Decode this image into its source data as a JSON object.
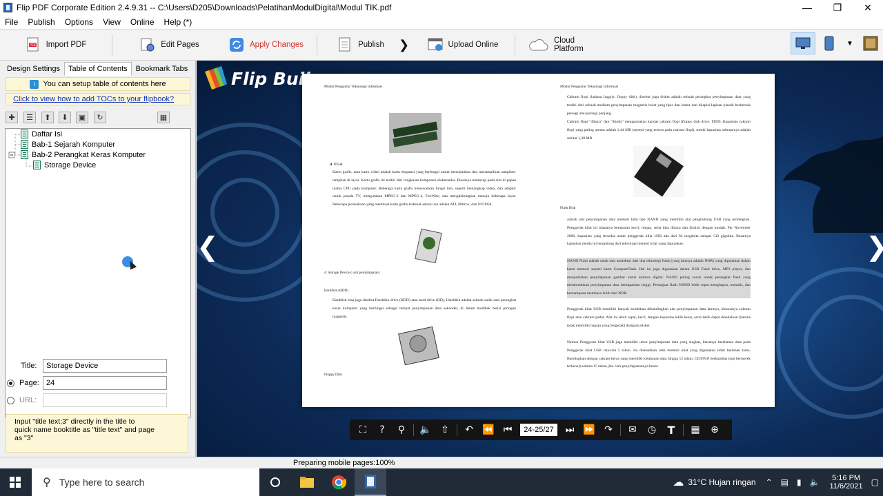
{
  "window": {
    "title": "Flip PDF Corporate Edition 2.4.9.31 -- C:\\Users\\D205\\Downloads\\PelatihanModulDigital\\Modul TIK.pdf"
  },
  "menu": [
    "File",
    "Publish",
    "Options",
    "View",
    "Online",
    "Help (*)"
  ],
  "toolbar": {
    "import": "Import PDF",
    "edit": "Edit Pages",
    "apply": "Apply Changes",
    "publish": "Publish",
    "upload": "Upload Online",
    "cloud": "Cloud Platform"
  },
  "left_panel": {
    "tabs": [
      "Design Settings",
      "Table of Contents",
      "Bookmark Tabs"
    ],
    "active_tab": "Table of Contents",
    "tip": "You can setup table of contents here",
    "howto_link": "Click to view how to add TOCs to your flipbook?",
    "tree": [
      "Daftar Isi",
      "Bab-1 Sejarah Komputer",
      "Bab-2 Perangkat Keras Komputer",
      "Storage Device"
    ],
    "title_label": "Title:",
    "title_value": "Storage Device",
    "page_label": "Page:",
    "page_value": "24",
    "url_label": "URL:",
    "url_value": "",
    "help": "Input \"title text;3\" directly in the title to\nquick name booktitle as \"title text\" and page\nas \"3\""
  },
  "viewer": {
    "logo": "Flip Buil",
    "page_indicator": "24-25/27",
    "left_page": {
      "header": "Modul Pengantar Teknologi Informasi",
      "vga_heading": "d.  VGA",
      "vga_text": "Kartu grafis, atau kartu video adalah kartu ekspansi yang berfungsi untuk menciptakan dan menampilkan tampilan-tampilan di layar. Kartu grafis ini terdiri dari rangkaian komponen elektronika. Biasanya tertancap pada slot di papan utama CPU pada komputer. Beberapa kartu grafis menawarkan fungsi lain, seperti menangkap video, dan adaptor untuk penala TV, mengurakan MPEG-2 dan MPEG-4, FireWire, dan menghubungkan menuju beberapa layar. Beberapa perusahaan yang membuat kartu grafis terkenal antara lain adalah ATI, Matrox, dan NVIDIA.",
      "storage_heading": "4.  Storage Device ( unit penyimpanan)",
      "hdd_heading": "Harddisk (HDD)",
      "hdd_text": "Harddisk bisa juga disebut Harddisk drive (HDD) atau hard drive (HD), Harddisk adalah sebuah salah satu perangkat keras komputer yang berfungsi sebagai tempat penyimpanan data sekunder, di dalam harddisk berisi piringan magnetis.",
      "floppy_heading": "Floppy Disk"
    },
    "right_page": {
      "header": "Modul Pengantar Teknologi Informasi",
      "p1": "Cakram flopi (bahasa Inggris: floppy disk), disebut juga disket adalah sebuah perangkat penyimpanan data yang terdiri dari sebuah medium penyimpanan magnetis bulat yang tipis dan lentur dan dilapisi lapisan plastik berbentuk persegi atau persegi panjang.",
      "p2": "Cakram flopi \"dibaca\" dan \"ditulis\" menggunakan kandar cakram flopi (floppy disk drive, FDD). Kapasitas cakram flopi yang paling umum adalah 1,44 MB (seperti yang tertera pada cakram flopi), meski kapasitas sebenarnya adalah sekitar 1,38 MB",
      "flash_heading": "Flash Disk",
      "p3": "adalah alat penyimpanan data memori kilat tipe NAND yang memiliki alat penghubung USB yang terintegrasi. Penggerak kilat ini biasanya berukuran kecil, ringan, serta bisa dibaca dan ditulisi dengan mudah. Per November 2006, kapasitas yang tersedia untuk penggerak kilat USB ada dari 64 megabita sampai 512 gigabita. Besarnya kapasitas media ini tergantung dari teknologi memori kilat yang digunakan.",
      "p4": "NAND Flash adalah salah satu arsitektur dari dua teknologi flash (yang lainnya adalah NOR) yang digunakan dalam kartu memori seperti kartu CompactFlash. Hal ini juga digunakan dalam USB Flash drive, MP3 player, dan menyediakan penyimpanan gambar untuk kamera digital. NAND paling cocok untuk perangkat flash yang membutuhkan penyimpanan data berkapasitas tinggi. Perangkat flash NAND lebih cepat menghapus, menulis, dan kemampuan membaca lebih dari NOR.",
      "p5": "Penggerak kilat USB memiliki banyak kelebihan dibandingkan alat penyimpanan data lainnya, khususnya cakram flopi atau cakram padat. Alat ini lebih cepat, kecil, dengan kapasitas lebih besar, serta lebih dapat diandalkan (karena tidak memiliki bagian yang bergerak) daripada disket.",
      "p6": "Namun Penggerak kilat USB juga memiliki umur penyimpanan data yang singkat, biasanya ketahanan data pada Penggerak kilat USB rata-rata 5 tahun. Ini disebabkan oleh memori kilat yang digunakan tidak bertahan lama. Bandingkan dengan cakram keras yang memiliki ketahanan data hingga 12 tahun, CD/DVD berkualitas (dan bermerek terkenal) selama 15 tahun jika cara penyimpanannya benar."
    }
  },
  "status": "Preparing mobile pages:100%",
  "taskbar": {
    "search_placeholder": "Type here to search",
    "weather": "31°C  Hujan ringan",
    "time": "5:16 PM",
    "date": "11/6/2021"
  },
  "colors": {
    "accent_apply": "#d0342c",
    "viewer_bg": "#0d2b58",
    "tip_bg": "#fdf7d8"
  }
}
